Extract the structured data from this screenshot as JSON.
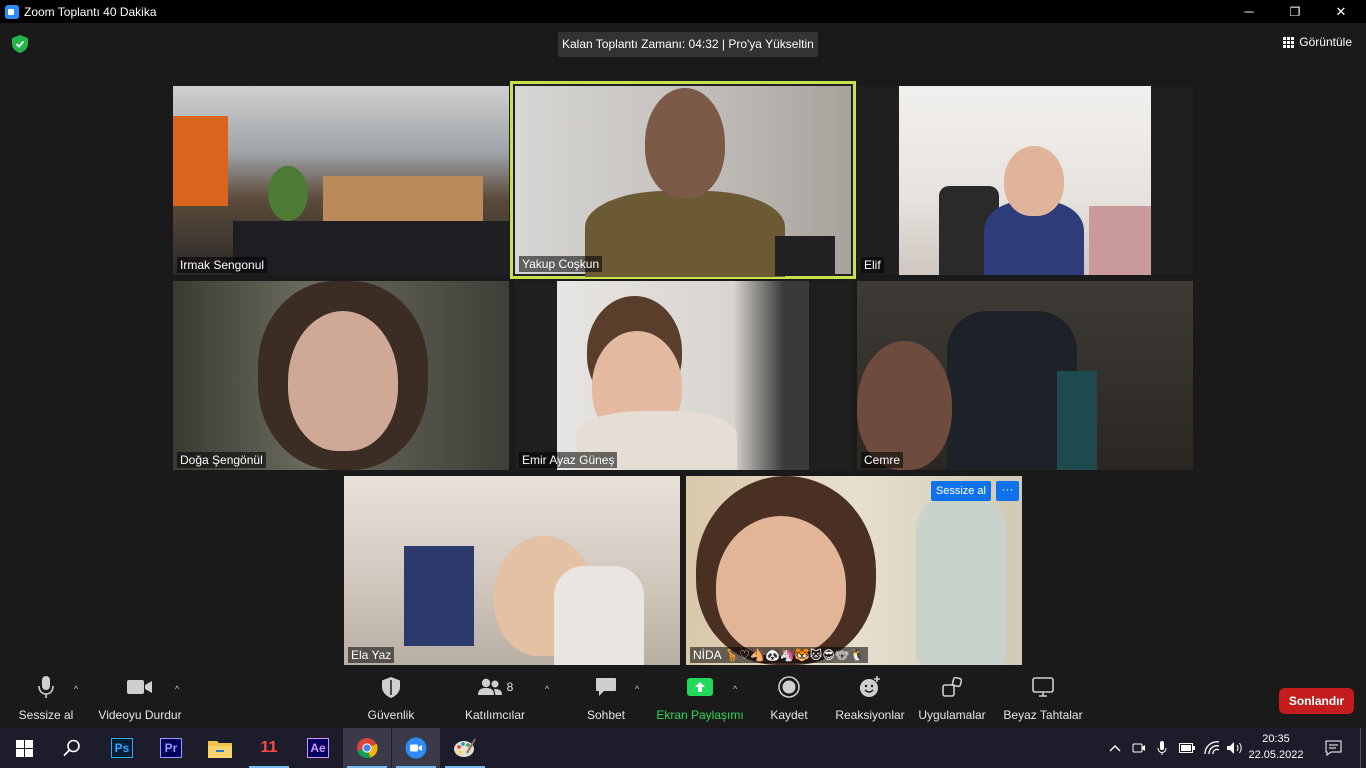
{
  "window": {
    "title": "Zoom Toplantı 40 Dakika",
    "minimize": "─",
    "restore": "❐",
    "close": "✕"
  },
  "meeting": {
    "timer": "Kalan Toplantı Zamanı: 04:32 | Pro'ya Yükseltin",
    "view_label": "Görüntüle"
  },
  "participants": [
    {
      "name": "Irmak Sengonul"
    },
    {
      "name": "Yakup Coşkun"
    },
    {
      "name": "Elif"
    },
    {
      "name": "Doğa Şengönül"
    },
    {
      "name": "Emir Ayaz Güneş"
    },
    {
      "name": "Cemre"
    },
    {
      "name": "Ela Yaz"
    },
    {
      "name": "NİDA 🦒♡🐴🐼🦄🐯🐱😎🐨🐧",
      "hover_mute": "Sessize al",
      "hover_more": "···"
    }
  ],
  "toolbar": {
    "mute": "Sessize al",
    "video": "Videoyu Durdur",
    "security": "Güvenlik",
    "participants": "Katılımcılar",
    "participants_count": "8",
    "chat": "Sohbet",
    "share": "Ekran Paylaşımı",
    "record": "Kaydet",
    "reactions": "Reaksiyonlar",
    "apps": "Uygulamalar",
    "whiteboard": "Beyaz Tahtalar",
    "end": "Sonlandır",
    "caret": "^"
  },
  "taskbar": {
    "apps": [
      "windows-start",
      "search",
      "photoshop",
      "premiere",
      "file-explorer",
      "app-11",
      "after-effects",
      "chrome",
      "zoom",
      "paint"
    ],
    "ps_label": "Ps",
    "pr_label": "Pr",
    "ae_label": "Ae",
    "app11_label": "11",
    "time": "20:35",
    "date": "22.05.2022"
  },
  "colors": {
    "active_speaker": "#c6e34b",
    "share_green": "#23d959",
    "end_red": "#c41c1c",
    "accent_blue": "#0e72ed"
  }
}
